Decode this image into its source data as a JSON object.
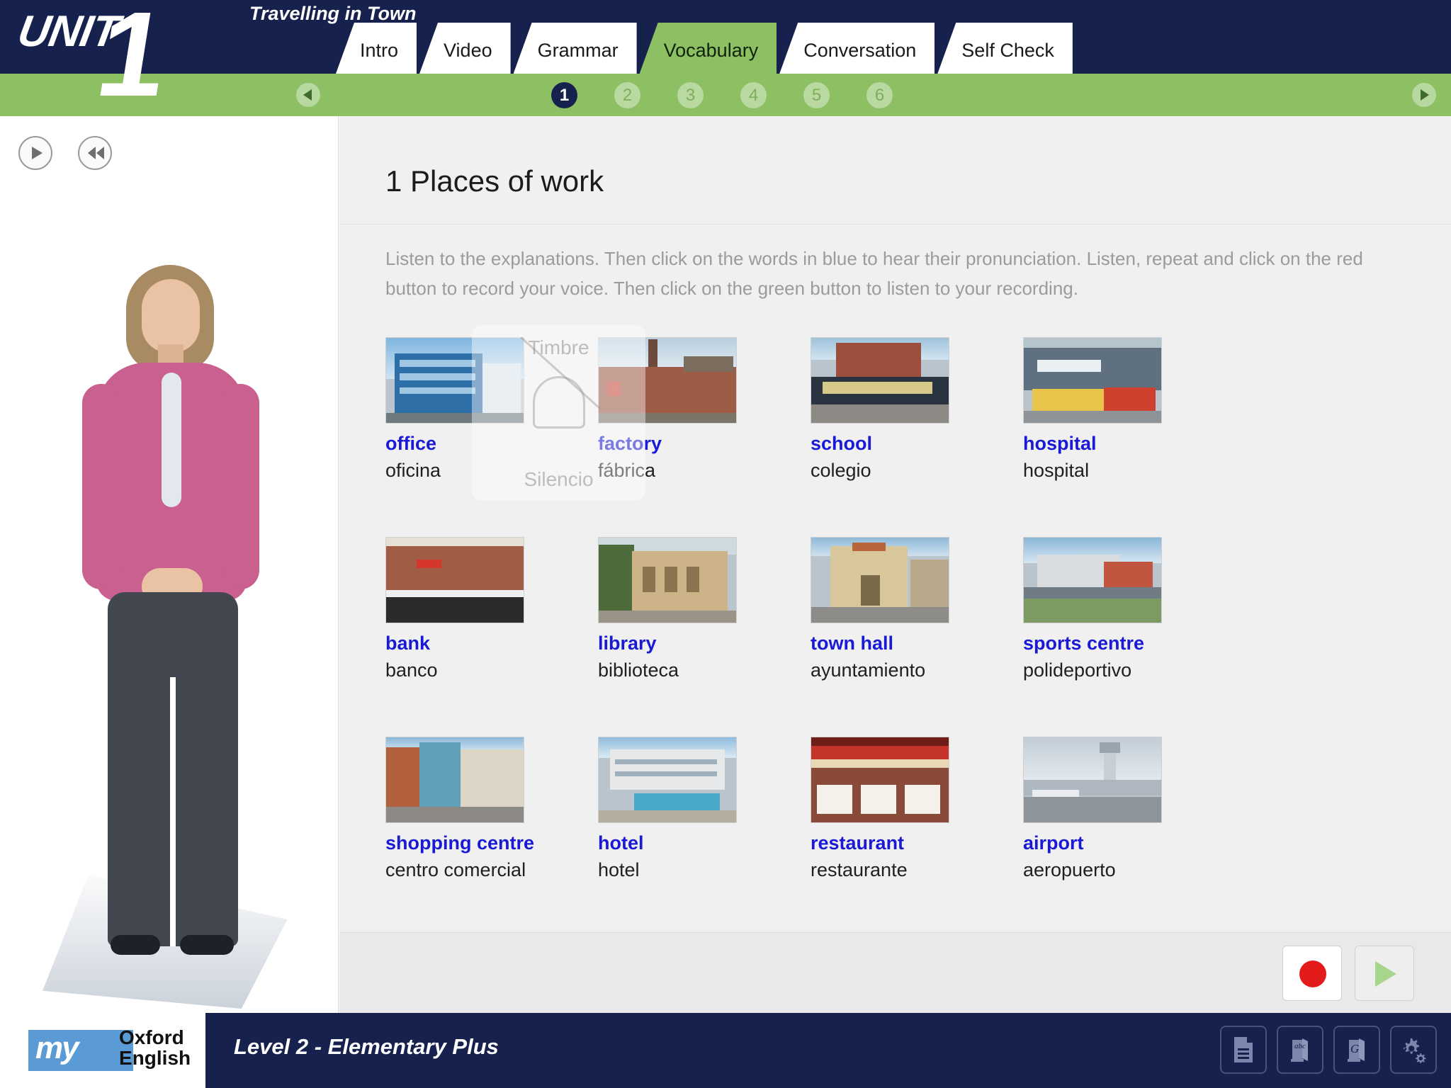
{
  "header": {
    "unit_word": "UNIT",
    "unit_number": "1",
    "course_title": "Travelling in Town",
    "tabs": [
      {
        "label": "Intro",
        "active": false
      },
      {
        "label": "Video",
        "active": false
      },
      {
        "label": "Grammar",
        "active": false
      },
      {
        "label": "Vocabulary",
        "active": true
      },
      {
        "label": "Conversation",
        "active": false
      },
      {
        "label": "Self Check",
        "active": false
      }
    ]
  },
  "pagination": {
    "prev_icon": "chevron-left-icon",
    "next_icon": "chevron-right-icon",
    "pages": [
      "1",
      "2",
      "3",
      "4",
      "5",
      "6"
    ],
    "current": "1"
  },
  "presenter": {
    "play_icon": "play-icon",
    "rewind_icon": "rewind-icon"
  },
  "main": {
    "title": "1 Places of work",
    "instructions": "Listen to the explanations. Then click on the words in blue to hear their pronunciation. Listen, repeat and click on the red button to record your voice. Then click on the green button to listen to your recording.",
    "vocabulary": [
      {
        "en": "office",
        "es": "oficina",
        "image": "modern-glass-office-building"
      },
      {
        "en": "factory",
        "es": "fábrica",
        "image": "brick-factory-with-chimney"
      },
      {
        "en": "school",
        "es": "colegio",
        "image": "school-building-with-students"
      },
      {
        "en": "hospital",
        "es": "hospital",
        "image": "hospital-with-ambulances"
      },
      {
        "en": "bank",
        "es": "banco",
        "image": "hsbc-bank-branch"
      },
      {
        "en": "library",
        "es": "biblioteca",
        "image": "stone-library-building"
      },
      {
        "en": "town hall",
        "es": "ayuntamiento",
        "image": "historic-town-hall"
      },
      {
        "en": "sports centre",
        "es": "polideportivo",
        "image": "modern-sports-centre"
      },
      {
        "en": "shopping centre",
        "es": "centro comercial",
        "image": "shopping-centre-entrance"
      },
      {
        "en": "hotel",
        "es": "hotel",
        "image": "hotel-with-pool"
      },
      {
        "en": "restaurant",
        "es": "restaurante",
        "image": "restaurant-terrace-tables"
      },
      {
        "en": "airport",
        "es": "aeropuerto",
        "image": "airport-with-control-tower"
      }
    ]
  },
  "watermark": {
    "top_label": "Timbre",
    "bottom_label": "Silencio",
    "icon": "bell-muted-icon"
  },
  "recorder": {
    "record_label": "record-button",
    "play_label": "play-recording-button",
    "record_icon": "record-circle-icon",
    "play_icon": "play-triangle-icon"
  },
  "footer": {
    "brand_my": "my",
    "brand_oxford": "Oxford",
    "brand_english": "English",
    "level": "Level 2 - Elementary Plus",
    "tools": [
      {
        "name": "transcript-icon",
        "glyph": "document"
      },
      {
        "name": "dictionary-abc-icon",
        "glyph": "abc-book"
      },
      {
        "name": "grammar-book-icon",
        "glyph": "g-book"
      },
      {
        "name": "settings-gears-icon",
        "glyph": "gears"
      }
    ]
  },
  "colors": {
    "navy": "#16214d",
    "green": "#8cc063",
    "blue_word": "#1a1ad6",
    "record_red": "#e31b1b",
    "play_green": "#a8d58c",
    "panel_grey": "#f0f0f0"
  }
}
